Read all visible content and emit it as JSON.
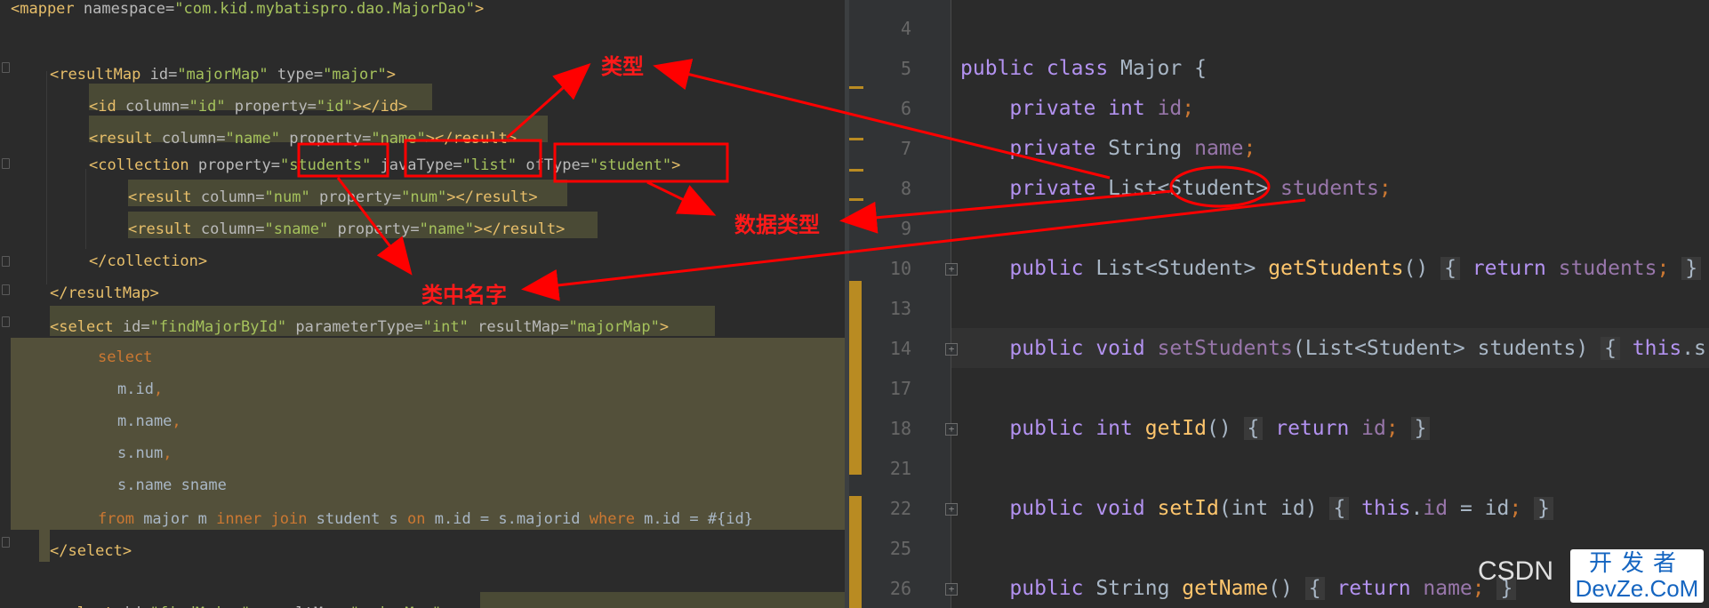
{
  "left_editor": {
    "lines": [
      {
        "parts": [
          {
            "c": "tag",
            "t": "<mapper"
          },
          {
            "c": "attr",
            "t": " namespace="
          },
          {
            "c": "val",
            "t": "\"com.kid.mybatispro.dao.MajorDao\""
          },
          {
            "c": "tag",
            "t": ">"
          }
        ]
      },
      {
        "parts": []
      },
      {
        "parts": [
          {
            "c": "tag",
            "t": "<resultMap"
          },
          {
            "c": "attr",
            "t": " id="
          },
          {
            "c": "val",
            "t": "\"majorMap\""
          },
          {
            "c": "attr",
            "t": " type="
          },
          {
            "c": "val",
            "t": "\"major\""
          },
          {
            "c": "tag",
            "t": ">"
          }
        ]
      },
      {
        "parts": [
          {
            "c": "tag",
            "t": "<id"
          },
          {
            "c": "attr",
            "t": " column="
          },
          {
            "c": "val",
            "t": "\"id\""
          },
          {
            "c": "attr",
            "t": " property="
          },
          {
            "c": "val",
            "t": "\"id\""
          },
          {
            "c": "tag",
            "t": "></id>"
          }
        ]
      },
      {
        "parts": [
          {
            "c": "tag",
            "t": "<result"
          },
          {
            "c": "attr",
            "t": " column="
          },
          {
            "c": "val",
            "t": "\"name\""
          },
          {
            "c": "attr",
            "t": " property="
          },
          {
            "c": "val",
            "t": "\"name\""
          },
          {
            "c": "tag",
            "t": "></result>"
          }
        ]
      },
      {
        "parts": [
          {
            "c": "tag",
            "t": "<collection"
          },
          {
            "c": "attr",
            "t": " property="
          },
          {
            "c": "val",
            "t": "\"students\""
          },
          {
            "c": "attr",
            "t": " javaType="
          },
          {
            "c": "val",
            "t": "\"list\""
          },
          {
            "c": "attr",
            "t": " ofType="
          },
          {
            "c": "val",
            "t": "\"student\""
          },
          {
            "c": "tag",
            "t": ">"
          }
        ]
      },
      {
        "parts": [
          {
            "c": "tag",
            "t": "<result"
          },
          {
            "c": "attr",
            "t": " column="
          },
          {
            "c": "val",
            "t": "\"num\""
          },
          {
            "c": "attr",
            "t": " property="
          },
          {
            "c": "val",
            "t": "\"num\""
          },
          {
            "c": "tag",
            "t": "></result>"
          }
        ]
      },
      {
        "parts": [
          {
            "c": "tag",
            "t": "<result"
          },
          {
            "c": "attr",
            "t": " column="
          },
          {
            "c": "val",
            "t": "\"sname\""
          },
          {
            "c": "attr",
            "t": " property="
          },
          {
            "c": "val",
            "t": "\"name\""
          },
          {
            "c": "tag",
            "t": "></result>"
          }
        ]
      },
      {
        "parts": [
          {
            "c": "tag",
            "t": "</collection>"
          }
        ]
      },
      {
        "parts": [
          {
            "c": "tag",
            "t": "</resultMap>"
          }
        ]
      },
      {
        "parts": [
          {
            "c": "tag",
            "t": "<select"
          },
          {
            "c": "attr",
            "t": " id="
          },
          {
            "c": "val",
            "t": "\"findMajorById\""
          },
          {
            "c": "attr",
            "t": " parameterType="
          },
          {
            "c": "val",
            "t": "\"int\""
          },
          {
            "c": "attr",
            "t": " resultMap="
          },
          {
            "c": "val",
            "t": "\"majorMap\""
          },
          {
            "c": "tag",
            "t": ">"
          }
        ]
      },
      {
        "parts": [
          {
            "c": "sql-kw",
            "t": "select"
          }
        ]
      },
      {
        "parts": [
          {
            "c": "sql-id",
            "t": "m.id"
          },
          {
            "c": "sql-kw",
            "t": ","
          }
        ]
      },
      {
        "parts": [
          {
            "c": "sql-id",
            "t": "m.name"
          },
          {
            "c": "sql-kw",
            "t": ","
          }
        ]
      },
      {
        "parts": [
          {
            "c": "sql-id",
            "t": "s.num"
          },
          {
            "c": "sql-kw",
            "t": ","
          }
        ]
      },
      {
        "parts": [
          {
            "c": "sql-id",
            "t": "s.name sname"
          }
        ]
      },
      {
        "parts": [
          {
            "c": "sql-kw",
            "t": "from"
          },
          {
            "c": "sql-id",
            "t": " major m "
          },
          {
            "c": "sql-kw",
            "t": "inner join"
          },
          {
            "c": "sql-id",
            "t": " student s "
          },
          {
            "c": "sql-kw",
            "t": "on"
          },
          {
            "c": "sql-id",
            "t": " m.id = s.majorid "
          },
          {
            "c": "sql-kw",
            "t": "where"
          },
          {
            "c": "sql-id",
            "t": " m.id = #{id}"
          }
        ]
      },
      {
        "parts": [
          {
            "c": "tag",
            "t": "</select>"
          }
        ]
      },
      {
        "parts": []
      },
      {
        "parts": [
          {
            "c": "tag",
            "t": "<select"
          },
          {
            "c": "attr",
            "t": " id="
          },
          {
            "c": "val",
            "t": "\"findMajor\""
          },
          {
            "c": "attr",
            "t": " resultMap="
          },
          {
            "c": "val",
            "t": "\"majorMap\""
          },
          {
            "c": "tag",
            "t": ">"
          }
        ]
      }
    ]
  },
  "right_editor": {
    "line_numbers": [
      "4",
      "5",
      "6",
      "7",
      "8",
      "9",
      "10",
      "13",
      "14",
      "17",
      "18",
      "21",
      "22",
      "25",
      "26"
    ],
    "lines": [
      {
        "parts": []
      },
      {
        "parts": [
          {
            "c": "kw2",
            "t": "public class "
          },
          {
            "c": "type",
            "t": "Major {"
          }
        ]
      },
      {
        "parts": [
          {
            "c": "kw2",
            "t": "    private int "
          },
          {
            "c": "fld",
            "t": "id"
          },
          {
            "c": "kw",
            "t": ";"
          }
        ]
      },
      {
        "parts": [
          {
            "c": "kw2",
            "t": "    private "
          },
          {
            "c": "type",
            "t": "String "
          },
          {
            "c": "fld",
            "t": "name"
          },
          {
            "c": "kw",
            "t": ";"
          }
        ]
      },
      {
        "parts": [
          {
            "c": "kw2",
            "t": "    private "
          },
          {
            "c": "type",
            "t": "List<Student> "
          },
          {
            "c": "fld",
            "t": "students"
          },
          {
            "c": "kw",
            "t": ";"
          }
        ]
      },
      {
        "parts": []
      },
      {
        "parts": [
          {
            "c": "kw2",
            "t": "    public "
          },
          {
            "c": "type",
            "t": "List<Student> "
          },
          {
            "c": "meth",
            "t": "getStudents"
          },
          {
            "c": "type",
            "t": "() "
          },
          {
            "c": "brace",
            "t": "{"
          },
          {
            "c": "kw2",
            "t": " return "
          },
          {
            "c": "fld",
            "t": "students"
          },
          {
            "c": "kw",
            "t": "; "
          },
          {
            "c": "brace",
            "t": "}"
          }
        ]
      },
      {
        "parts": []
      },
      {
        "parts": [
          {
            "c": "kw2",
            "t": "    public void "
          },
          {
            "c": "fld",
            "t": "setStudents"
          },
          {
            "c": "type",
            "t": "(List<Student> students) "
          },
          {
            "c": "brace",
            "t": "{"
          },
          {
            "c": "kw2",
            "t": " this"
          },
          {
            "c": "type",
            "t": ".s"
          }
        ]
      },
      {
        "parts": []
      },
      {
        "parts": [
          {
            "c": "kw2",
            "t": "    public int "
          },
          {
            "c": "meth",
            "t": "getId"
          },
          {
            "c": "type",
            "t": "() "
          },
          {
            "c": "brace",
            "t": "{"
          },
          {
            "c": "kw2",
            "t": " return "
          },
          {
            "c": "fld",
            "t": "id"
          },
          {
            "c": "kw",
            "t": "; "
          },
          {
            "c": "brace",
            "t": "}"
          }
        ]
      },
      {
        "parts": []
      },
      {
        "parts": [
          {
            "c": "kw2",
            "t": "    public void "
          },
          {
            "c": "meth",
            "t": "setId"
          },
          {
            "c": "type",
            "t": "(int id) "
          },
          {
            "c": "brace",
            "t": "{"
          },
          {
            "c": "kw2",
            "t": " this"
          },
          {
            "c": "type",
            "t": "."
          },
          {
            "c": "fld",
            "t": "id"
          },
          {
            "c": "type",
            "t": " = id"
          },
          {
            "c": "kw",
            "t": "; "
          },
          {
            "c": "brace",
            "t": "}"
          }
        ]
      },
      {
        "parts": []
      },
      {
        "parts": [
          {
            "c": "kw2",
            "t": "    public "
          },
          {
            "c": "type",
            "t": "String "
          },
          {
            "c": "meth",
            "t": "getName"
          },
          {
            "c": "type",
            "t": "() "
          },
          {
            "c": "brace",
            "t": "{"
          },
          {
            "c": "kw2",
            "t": " return "
          },
          {
            "c": "fld",
            "t": "name"
          },
          {
            "c": "kw",
            "t": "; "
          },
          {
            "c": "brace",
            "t": "}"
          }
        ]
      }
    ]
  },
  "annotations": {
    "type_label": "类型",
    "data_type_label": "数据类型",
    "name_in_class_label": "类中名字",
    "color": "#ff0000"
  },
  "watermark": {
    "csdn": "CSDN",
    "logo_top": "开发者",
    "logo_bottom": "DevZe.CoM"
  }
}
